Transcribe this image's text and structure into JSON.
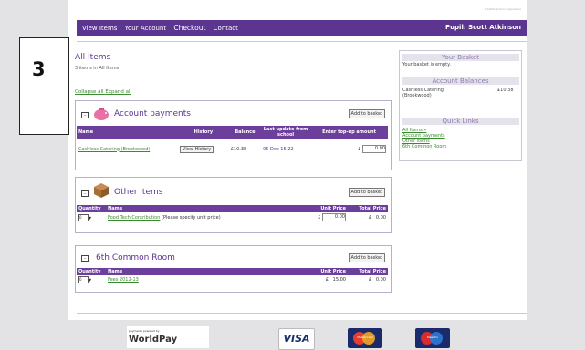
{
  "badge_number": "3",
  "header_tag": "A better school experience",
  "nav": {
    "items": [
      "View Items",
      "Your Account",
      "Checkout",
      "Contact"
    ],
    "pupil": "Pupil: Scott Atkinson"
  },
  "main": {
    "title": "All Items",
    "subtitle": "3 items in All Items",
    "collapse_all": "Collapse all",
    "expand_all": "Expand all"
  },
  "account_payments": {
    "heading": "Account payments",
    "add_to_basket": "Add to basket",
    "columns": [
      "Name",
      "History",
      "Balance",
      "Last update from school",
      "Enter top-up amount"
    ],
    "row": {
      "name": "Cashless Catering (Brookwood)",
      "history_button": "View History",
      "balance": "£10.38",
      "last_update": "05 Dec 15:22",
      "currency": "£",
      "amount": "0.00"
    }
  },
  "other_items": {
    "heading": "Other items",
    "add_to_basket": "Add to basket",
    "columns": [
      "Quantity",
      "Name",
      "Unit Price",
      "Total Price"
    ],
    "row": {
      "quantity": "0",
      "name": "Food Tech Contribution",
      "note": "(Please specify unit price)",
      "currency": "£",
      "unit_price": "0.00",
      "total_currency": "£",
      "total": "0.00"
    }
  },
  "common_room": {
    "heading": "6th Common Room",
    "add_to_basket": "Add to basket",
    "columns": [
      "Quantity",
      "Name",
      "Unit Price",
      "Total Price"
    ],
    "row": {
      "quantity": "0",
      "name": "Fees 2012-13",
      "currency": "£",
      "unit_price": "15.00",
      "total_currency": "£",
      "total": "0.00"
    }
  },
  "sidebar": {
    "basket_title": "Your Basket",
    "basket_text": "Your basket is empty.",
    "balances_title": "Account Balances",
    "balance_name": "Cashless Catering (Brookwood)",
    "balance_value": "£10.38",
    "quick_title": "Quick Links",
    "quick_links": [
      "All Items »",
      "Account payments",
      "Other items",
      "6th Common Room"
    ]
  },
  "footer": {
    "worldpay_small": "payments powered by",
    "worldpay_big": "WorldPay",
    "visa": "VISA",
    "mastercard": "MasterCard",
    "maestro": "Maestro"
  }
}
